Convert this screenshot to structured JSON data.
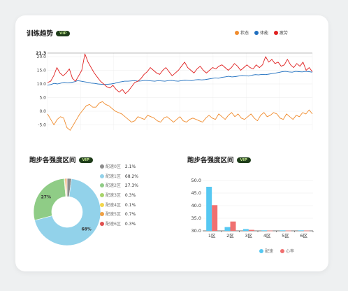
{
  "trend": {
    "title": "训练趋势",
    "vip": "VIP",
    "legend": [
      {
        "name": "状态",
        "color": "#f08c2e"
      },
      {
        "name": "体能",
        "color": "#1f6fbf"
      },
      {
        "name": "疲劳",
        "color": "#e02020"
      }
    ]
  },
  "pie": {
    "title": "跑步各强度区间",
    "vip": "VIP",
    "zones": [
      {
        "label": "配速0区",
        "value": "2.1%",
        "color": "#8c8c8c"
      },
      {
        "label": "配速1区",
        "value": "68.2%",
        "color": "#92d2ea"
      },
      {
        "label": "配速2区",
        "value": "27.3%",
        "color": "#8fcc86"
      },
      {
        "label": "配速3区",
        "value": "0.3%",
        "color": "#a8d46b"
      },
      {
        "label": "配速4区",
        "value": "0.1%",
        "color": "#f2d64b"
      },
      {
        "label": "配速5区",
        "value": "0.7%",
        "color": "#f0a045"
      },
      {
        "label": "配速6区",
        "value": "0.3%",
        "color": "#e05050"
      }
    ]
  },
  "bar": {
    "title": "跑步各强度区间",
    "vip": "VIP",
    "legend": [
      {
        "name": "配速",
        "color": "#56c8f2"
      },
      {
        "name": "心率",
        "color": "#f07070"
      }
    ]
  },
  "chart_data": [
    {
      "type": "line",
      "title": "训练趋势",
      "y_max_label": "21.3",
      "ylim": [
        -5,
        21.3
      ],
      "yticks": [
        -5,
        0,
        5,
        10,
        15,
        20
      ],
      "grid": true,
      "legend_position": "top-right",
      "series": [
        {
          "name": "体能",
          "color": "#1f6fbf",
          "values": [
            9.5,
            9.8,
            10.2,
            10.0,
            10.3,
            10.6,
            10.4,
            10.5,
            10.8,
            11.2,
            11.0,
            10.8,
            10.6,
            10.3,
            10.2,
            10.0,
            9.9,
            9.8,
            9.9,
            10.0,
            10.2,
            10.6,
            10.8,
            11.0,
            11.0,
            11.1,
            11.2,
            11.0,
            11.1,
            11.3,
            11.2,
            11.1,
            11.0,
            11.2,
            11.1,
            11.0,
            11.2,
            11.3,
            11.1,
            11.0,
            11.2,
            11.4,
            11.3,
            11.2,
            11.5,
            11.6,
            11.5,
            11.6,
            11.8,
            12.0,
            12.2,
            12.1,
            12.4,
            12.6,
            12.8,
            12.6,
            12.7,
            12.9,
            13.1,
            13.0,
            12.9,
            13.2,
            13.4,
            13.3,
            13.5,
            13.4,
            13.6,
            13.8,
            14.0,
            14.2,
            14.5,
            14.6,
            14.4,
            14.3,
            14.6,
            14.5,
            14.4,
            14.6,
            14.5,
            14.3
          ]
        },
        {
          "name": "疲劳",
          "color": "#e02020",
          "values": [
            10.5,
            11.0,
            13.0,
            16.0,
            14.0,
            13.0,
            14.0,
            15.5,
            12.0,
            11.0,
            13.0,
            15.0,
            21.0,
            18.0,
            16.0,
            14.0,
            12.5,
            11.0,
            10.0,
            9.0,
            8.5,
            9.5,
            8.0,
            7.0,
            8.0,
            6.5,
            7.5,
            9.0,
            10.5,
            11.0,
            12.0,
            13.5,
            14.5,
            16.0,
            15.0,
            14.0,
            13.5,
            15.0,
            16.0,
            14.5,
            13.0,
            14.0,
            15.0,
            16.5,
            18.0,
            16.0,
            15.0,
            14.0,
            15.5,
            16.5,
            15.0,
            14.0,
            15.0,
            16.0,
            15.5,
            16.5,
            17.0,
            16.0,
            15.0,
            16.0,
            17.5,
            16.5,
            15.0,
            16.0,
            17.0,
            16.0,
            15.5,
            17.0,
            16.0,
            17.0,
            20.0,
            18.0,
            19.0,
            17.5,
            18.0,
            16.5,
            17.0,
            19.0,
            17.0,
            16.0,
            17.5,
            16.5,
            18.0,
            15.0,
            16.0,
            14.5
          ]
        },
        {
          "name": "状态",
          "color": "#f08c2e",
          "values": [
            -1.0,
            -3.0,
            -5.0,
            -3.0,
            -2.0,
            -2.5,
            -6.0,
            -7.0,
            -5.0,
            -3.0,
            -1.0,
            0.5,
            2.0,
            2.5,
            1.5,
            1.5,
            3.0,
            3.5,
            2.5,
            2.0,
            1.0,
            0.0,
            -0.5,
            -1.0,
            -2.0,
            -3.0,
            -4.0,
            -3.5,
            -2.0,
            -2.5,
            -3.0,
            -1.5,
            -2.0,
            -2.5,
            -3.5,
            -4.0,
            -2.5,
            -2.0,
            -3.0,
            -4.0,
            -3.0,
            -2.0,
            -3.5,
            -4.0,
            -3.0,
            -2.5,
            -3.0,
            -3.5,
            -4.0,
            -2.5,
            -1.5,
            -2.5,
            -3.0,
            -1.0,
            -2.0,
            -3.0,
            -1.5,
            -0.5,
            -2.0,
            -1.0,
            -2.5,
            -3.0,
            -2.0,
            -1.0,
            -2.5,
            -3.5,
            -1.5,
            -0.5,
            -2.0,
            -1.5,
            -0.5,
            -1.0,
            -2.5,
            -3.0,
            -1.0,
            -2.0,
            -3.0,
            -1.5,
            -2.0,
            -0.5,
            -1.0,
            0.5,
            -1.0
          ]
        }
      ]
    },
    {
      "type": "pie",
      "title": "跑步各强度区间",
      "slices": [
        {
          "name": "配速0区",
          "value": 2.1
        },
        {
          "name": "配速1区",
          "value": 68.2,
          "label": "68%"
        },
        {
          "name": "配速2区",
          "value": 27.3,
          "label": "27%"
        },
        {
          "name": "配速3区",
          "value": 0.3
        },
        {
          "name": "配速4区",
          "value": 0.1
        },
        {
          "name": "配速5区",
          "value": 0.7
        },
        {
          "name": "配速6区",
          "value": 0.3
        }
      ]
    },
    {
      "type": "bar",
      "title": "跑步各强度区间",
      "categories": [
        "1区",
        "2区",
        "3区",
        "4区",
        "5区",
        "6区"
      ],
      "ylim": [
        30,
        50
      ],
      "yticks": [
        "30.0",
        "35.0",
        "40.0",
        "45.0",
        "50.0"
      ],
      "series": [
        {
          "name": "配速",
          "values": [
            47.5,
            31.5,
            30.7,
            30.2,
            30.2,
            30.2
          ]
        },
        {
          "name": "心率",
          "values": [
            40.2,
            33.7,
            30.4,
            30.1,
            30.1,
            30.1
          ]
        }
      ]
    }
  ]
}
